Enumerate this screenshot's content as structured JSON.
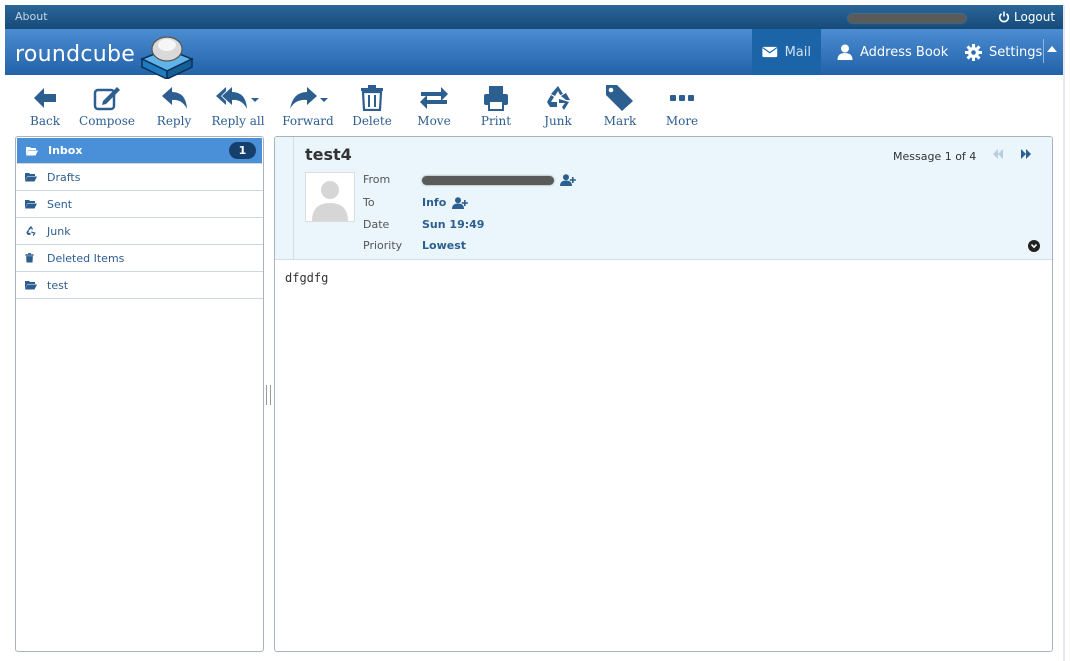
{
  "topline": {
    "about": "About",
    "logout": "Logout"
  },
  "header": {
    "logo_text": "roundcube",
    "tasks": {
      "mail": "Mail",
      "address_book": "Address Book",
      "settings": "Settings"
    }
  },
  "toolbar": {
    "back": "Back",
    "compose": "Compose",
    "reply": "Reply",
    "reply_all": "Reply all",
    "forward": "Forward",
    "delete": "Delete",
    "move": "Move",
    "print": "Print",
    "junk": "Junk",
    "mark": "Mark",
    "more": "More"
  },
  "folders": [
    {
      "label": "Inbox",
      "icon": "folder-open-icon",
      "unread": "1",
      "selected": true
    },
    {
      "label": "Drafts",
      "icon": "folder-open-icon"
    },
    {
      "label": "Sent",
      "icon": "folder-open-icon"
    },
    {
      "label": "Junk",
      "icon": "recycle-icon"
    },
    {
      "label": "Deleted Items",
      "icon": "trash-icon"
    },
    {
      "label": "test",
      "icon": "folder-open-icon"
    }
  ],
  "message": {
    "subject": "test4",
    "counter": "Message 1 of 4",
    "labels": {
      "from": "From",
      "to": "To",
      "date": "Date",
      "priority": "Priority"
    },
    "to": "Info",
    "date": "Sun 19:49",
    "priority": "Lowest",
    "body": "dfgdfg"
  },
  "colors": {
    "header": "#2262a9",
    "accent": "#4a90d9",
    "link": "#2c5e8f",
    "badge": "#16406c"
  }
}
